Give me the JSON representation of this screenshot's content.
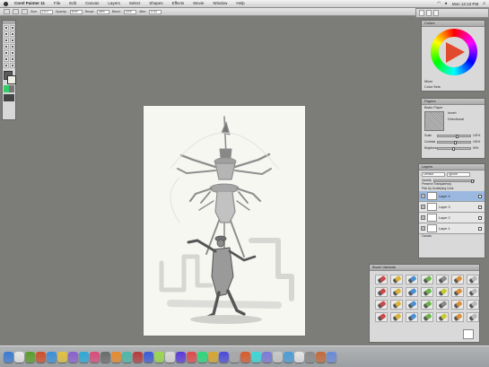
{
  "menubar": {
    "app_name": "Corel Painter 11",
    "items": [
      "File",
      "Edit",
      "Canvas",
      "Layers",
      "Select",
      "Shapes",
      "Effects",
      "Movie",
      "Window",
      "Help"
    ],
    "clock": "Mon 12:13 PM"
  },
  "property_bar": {
    "fields": [
      {
        "label": "Size:",
        "value": "10.0"
      },
      {
        "label": "Opacity:",
        "value": "50%"
      },
      {
        "label": "Resat:",
        "value": "46%"
      },
      {
        "label": "Bleed:",
        "value": "14%"
      },
      {
        "label": "Jitter:",
        "value": "0.00"
      }
    ]
  },
  "colors_panel": {
    "title": "Colors",
    "rows": [
      "Mixer",
      "Color Sets"
    ]
  },
  "paper_panel": {
    "title": "Papers",
    "paper_name": "Basic Paper",
    "options": [
      "Invert",
      "Directional"
    ],
    "sliders": [
      {
        "label": "Scale",
        "value": "100%",
        "fraction": 0.55
      },
      {
        "label": "Contrast",
        "value": "100%",
        "fraction": 0.5
      },
      {
        "label": "Brightness",
        "value": "50%",
        "fraction": 0.45
      }
    ]
  },
  "layers_panel": {
    "title": "Layers",
    "tabs": [
      "Default",
      "Ignore"
    ],
    "opacity_label": "Opacity",
    "options": [
      "Preserve Transparency",
      "Pick Up Underlying Color"
    ],
    "layers": [
      {
        "name": "Layer 4",
        "selected": true
      },
      {
        "name": "Layer 3",
        "selected": false
      },
      {
        "name": "Layer 2",
        "selected": false
      },
      {
        "name": "Layer 1",
        "selected": false
      }
    ],
    "canvas_label": "Canvas"
  },
  "variants_panel": {
    "title": "Brush Variants",
    "brush_colors": [
      "#c94a4a",
      "#d9b23a",
      "#4a8fd0",
      "#6cb34a",
      "#8a8a8a",
      "#d9903a",
      "#b9b9b9",
      "#c94a4a",
      "#d9b23a",
      "#4a8fd0",
      "#6cb34a",
      "#c9c930",
      "#d9903a",
      "#b9b9b9",
      "#c94a4a",
      "#d9b23a",
      "#4a8fd0",
      "#6cb34a",
      "#8a8a8a",
      "#d9903a",
      "#b9b9b9",
      "#c94a4a",
      "#d9b23a",
      "#4a8fd0",
      "#6cb34a",
      "#c9c930",
      "#d9903a",
      "#b9b9b9"
    ]
  },
  "toolbox": {
    "tool_count": 14
  },
  "dock": {
    "icons": [
      "#3a7bd5",
      "#e8e8e8",
      "#5a9e2a",
      "#d14d2a",
      "#3b8fd9",
      "#e4c23a",
      "#8a5fd1",
      "#2aa9d9",
      "#d94a7a",
      "#6a6a6a",
      "#e98a2a",
      "#4ab8a8",
      "#b53a3a",
      "#3a5bd9",
      "#9ad94a",
      "#d9d9d9",
      "#5a3ad9",
      "#e04a4a",
      "#2ad97a",
      "#d9a62a",
      "#4a4ad9",
      "#a8a8a8",
      "#d95a2a",
      "#3ad9d9",
      "#7a7ad9",
      "#c9c9c9",
      "#4a9ed9",
      "#e6e6e6",
      "#8a8a8a",
      "#c46a3a",
      "#6a8ad9"
    ]
  }
}
